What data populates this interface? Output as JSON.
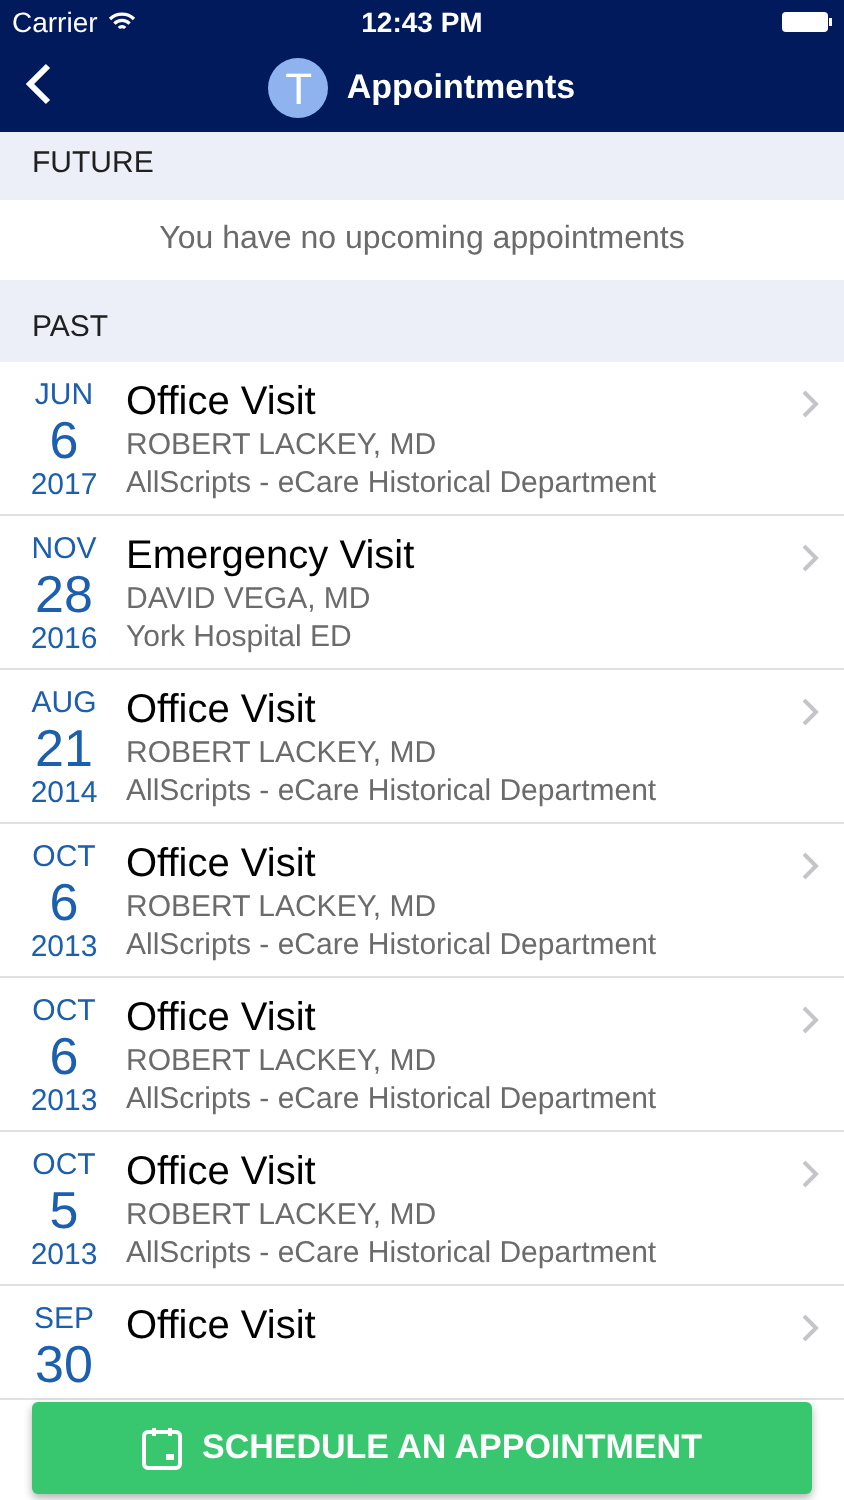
{
  "status_bar": {
    "carrier": "Carrier",
    "time": "12:43 PM"
  },
  "nav": {
    "avatar_letter": "T",
    "title": "Appointments"
  },
  "future": {
    "header": "FUTURE",
    "message": "You have no upcoming appointments"
  },
  "past": {
    "header": "PAST",
    "appointments": [
      {
        "month": "JUN",
        "day": "6",
        "year": "2017",
        "type": "Office Visit",
        "doctor": "ROBERT LACKEY, MD",
        "location": "AllScripts - eCare Historical Department"
      },
      {
        "month": "NOV",
        "day": "28",
        "year": "2016",
        "type": "Emergency Visit",
        "doctor": "DAVID VEGA, MD",
        "location": "York Hospital ED"
      },
      {
        "month": "AUG",
        "day": "21",
        "year": "2014",
        "type": "Office Visit",
        "doctor": "ROBERT LACKEY, MD",
        "location": "AllScripts - eCare Historical Department"
      },
      {
        "month": "OCT",
        "day": "6",
        "year": "2013",
        "type": "Office Visit",
        "doctor": "ROBERT LACKEY, MD",
        "location": "AllScripts - eCare Historical Department"
      },
      {
        "month": "OCT",
        "day": "6",
        "year": "2013",
        "type": "Office Visit",
        "doctor": "ROBERT LACKEY, MD",
        "location": "AllScripts - eCare Historical Department"
      },
      {
        "month": "OCT",
        "day": "5",
        "year": "2013",
        "type": "Office Visit",
        "doctor": "ROBERT LACKEY, MD",
        "location": "AllScripts - eCare Historical Department"
      },
      {
        "month": "SEP",
        "day": "30",
        "type": "Office Visit"
      }
    ]
  },
  "schedule_button": {
    "label": "SCHEDULE AN APPOINTMENT"
  }
}
